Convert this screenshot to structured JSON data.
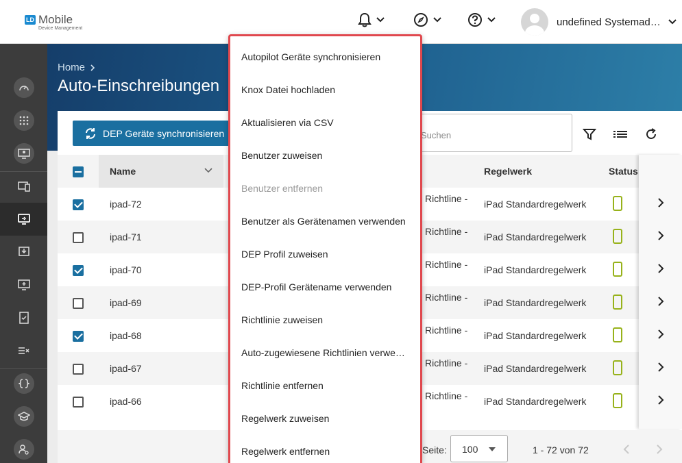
{
  "topbar": {
    "logo_badge": "LD",
    "logo_main": "Mobile",
    "logo_sub": "Device Management",
    "user_name": "undefined Systemadministrator"
  },
  "breadcrumb": {
    "home": "Home"
  },
  "page_title": "Auto-Einschreibungen",
  "toolbar": {
    "sync_button": "DEP Geräte synchronisieren",
    "search_placeholder": "Suchen"
  },
  "table": {
    "columns": {
      "name": "Name",
      "ruleset": "Regelwerk",
      "status": "Status"
    },
    "rows": [
      {
        "name": "ipad-72",
        "checked": true,
        "policy": "Richtline -",
        "ruleset": "iPad Standardregelwerk"
      },
      {
        "name": "ipad-71",
        "checked": false,
        "policy": "Richtline -",
        "ruleset": "iPad Standardregelwerk"
      },
      {
        "name": "ipad-70",
        "checked": true,
        "policy": "Richtline -",
        "ruleset": "iPad Standardregelwerk"
      },
      {
        "name": "ipad-69",
        "checked": false,
        "policy": "Richtline -",
        "ruleset": "iPad Standardregelwerk"
      },
      {
        "name": "ipad-68",
        "checked": true,
        "policy": "Richtline -",
        "ruleset": "iPad Standardregelwerk"
      },
      {
        "name": "ipad-67",
        "checked": false,
        "policy": "Richtline -",
        "ruleset": "iPad Standardregelwerk"
      },
      {
        "name": "ipad-66",
        "checked": false,
        "policy": "Richtline -",
        "ruleset": "iPad Standardregelwerk"
      }
    ]
  },
  "footer": {
    "per_page_label": "Seite:",
    "per_page_value": "100",
    "range": "1 - 72 von 72"
  },
  "menu": {
    "items": [
      {
        "label": "Autopilot Geräte synchronisieren",
        "disabled": false
      },
      {
        "label": "Knox Datei hochladen",
        "disabled": false
      },
      {
        "label": "Aktualisieren via CSV",
        "disabled": false
      },
      {
        "label": "Benutzer zuweisen",
        "disabled": false
      },
      {
        "label": "Benutzer entfernen",
        "disabled": true
      },
      {
        "label": "Benutzer als Gerätenamen verwenden",
        "disabled": false
      },
      {
        "label": "DEP Profil zuweisen",
        "disabled": false
      },
      {
        "label": "DEP-Profil Gerätename verwenden",
        "disabled": false
      },
      {
        "label": "Richtlinie zuweisen",
        "disabled": false
      },
      {
        "label": "Auto-zugewiesene Richtlinien verwenden",
        "disabled": false
      },
      {
        "label": "Richtlinie entfernen",
        "disabled": false
      },
      {
        "label": "Regelwerk zuweisen",
        "disabled": false
      },
      {
        "label": "Regelwerk entfernen",
        "disabled": false
      }
    ]
  },
  "colors": {
    "accent": "#1a6fa0",
    "status_ok": "#97b21a",
    "menu_highlight": "#e0484e"
  }
}
